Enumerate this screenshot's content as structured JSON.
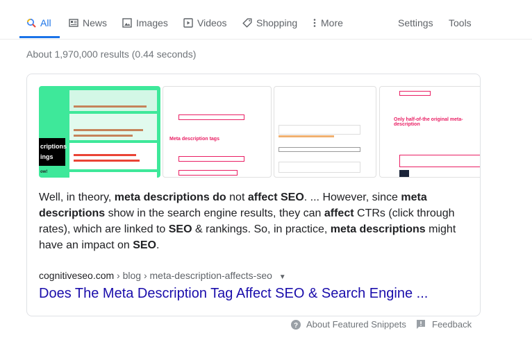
{
  "tabs": [
    {
      "label": "All",
      "icon": "search-icon",
      "active": true
    },
    {
      "label": "News",
      "icon": "news-icon"
    },
    {
      "label": "Images",
      "icon": "image-icon"
    },
    {
      "label": "Videos",
      "icon": "video-icon"
    },
    {
      "label": "Shopping",
      "icon": "tag-icon"
    },
    {
      "label": "More",
      "icon": "more-vert-icon"
    }
  ],
  "tools": {
    "settings": "Settings",
    "tools": "Tools"
  },
  "stats": "About 1,970,000 results (0.44 seconds)",
  "snippet": {
    "thumbnails": [
      {
        "caption_lines": [
          "criptions",
          "ings",
          "ow!"
        ]
      },
      {
        "annotation": "Meta description tags"
      },
      {
        "annotation": ""
      },
      {
        "annotation": "Only half-of-the original meta-description"
      }
    ],
    "paragraph": [
      {
        "t": "Well, in theory, "
      },
      {
        "t": "meta descriptions do",
        "b": true
      },
      {
        "t": " not "
      },
      {
        "t": "affect SEO",
        "b": true
      },
      {
        "t": ". ... However, since "
      },
      {
        "t": "meta descriptions",
        "b": true
      },
      {
        "t": " show in the search engine results, they can "
      },
      {
        "t": "affect",
        "b": true
      },
      {
        "t": " CTRs (click through rates), which are linked to "
      },
      {
        "t": "SEO",
        "b": true
      },
      {
        "t": " & rankings. So, in practice, "
      },
      {
        "t": "meta descriptions",
        "b": true
      },
      {
        "t": " might have an impact on "
      },
      {
        "t": "SEO",
        "b": true
      },
      {
        "t": "."
      }
    ],
    "breadcrumb": {
      "domain": "cognitiveseo.com",
      "path": " › blog › meta-description-affects-seo"
    },
    "title": "Does The Meta Description Tag Affect SEO & Search Engine ..."
  },
  "footer": {
    "about": "About Featured Snippets",
    "feedback": "Feedback"
  },
  "colors": {
    "accent": "#1a73e8",
    "link": "#1a0dab",
    "thumb_green": "#3ee89a"
  }
}
